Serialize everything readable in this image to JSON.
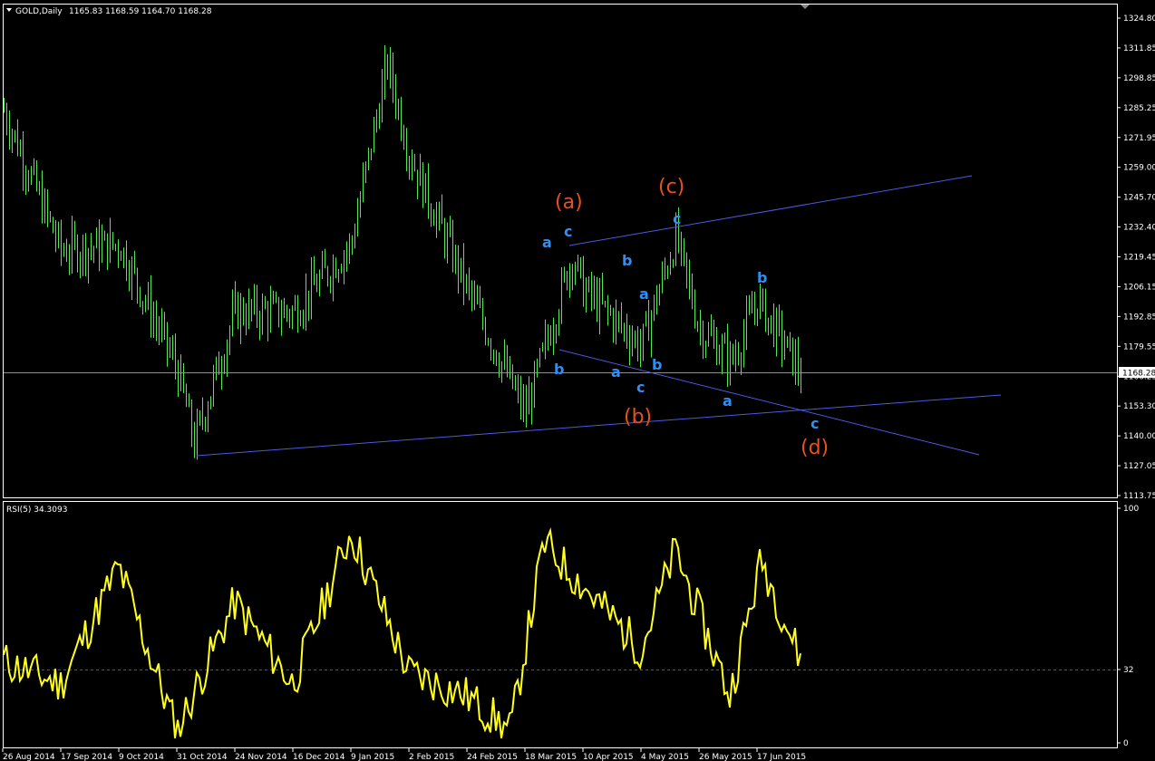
{
  "header": {
    "symbol_label": "GOLD,Daily",
    "ohlc_text": "1165.83 1168.59 1164.70 1168.28",
    "menu_icon": "triangle-down-icon",
    "scroll_marker_icon": "shift-marker-icon"
  },
  "colors": {
    "background": "#000000",
    "frame": "#ffffff",
    "candle": "#4fe84f",
    "trendline": "#4a5be0",
    "current_price_line": "#7b8ad6",
    "rsi_line": "#ffff1a",
    "rsi_level": "#3c4fc8",
    "wave_minor": "#2f8ff5",
    "wave_major": "#e8501e"
  },
  "price_panel": {
    "current_price_label": "1168.28",
    "y_ticks": [
      "1324.80",
      "1311.85",
      "1298.85",
      "1285.25",
      "1271.95",
      "1259.00",
      "1245.70",
      "1232.40",
      "1219.45",
      "1206.15",
      "1192.85",
      "1179.55",
      "1166.25",
      "1153.30",
      "1140.00",
      "1127.05",
      "1113.75"
    ]
  },
  "rsi_panel": {
    "label": "RSI(5) 34.3093",
    "y_ticks": [
      "100",
      "32",
      "0"
    ]
  },
  "x_ticks": [
    "26 Aug 2014",
    "17 Sep 2014",
    "9 Oct 2014",
    "31 Oct 2014",
    "24 Nov 2014",
    "16 Dec 2014",
    "9 Jan 2015",
    "2 Feb 2015",
    "24 Feb 2015",
    "18 Mar 2015",
    "10 Apr 2015",
    "4 May 2015",
    "26 May 2015",
    "17 Jun 2015"
  ],
  "wave_labels": {
    "minor": [
      "a",
      "c",
      "b",
      "a",
      "a",
      "b",
      "c",
      "c",
      "b",
      "a",
      "b",
      "c"
    ],
    "major": [
      "(a)",
      "(c)",
      "(b)",
      "(d)"
    ]
  },
  "chart_data": [
    {
      "type": "line",
      "name_hint": "price",
      "ylim": [
        1113.75,
        1330.0
      ],
      "last_close": 1168.28,
      "key_values": [
        {
          "x": "26 Aug 2014",
          "y": 1285
        },
        {
          "x": "17 Sep 2014",
          "y": 1222
        },
        {
          "x": "9 Oct 2014",
          "y": 1225
        },
        {
          "x": "31 Oct 2014",
          "y": 1170
        },
        {
          "x": "7 Nov 2014",
          "y": 1137
        },
        {
          "x": "24 Nov 2014",
          "y": 1195
        },
        {
          "x": "16 Dec 2014",
          "y": 1195
        },
        {
          "x": "9 Jan 2015",
          "y": 1225
        },
        {
          "x": "23 Jan 2015",
          "y": 1305
        },
        {
          "x": "2 Feb 2015",
          "y": 1265
        },
        {
          "x": "24 Feb 2015",
          "y": 1205
        },
        {
          "x": "18 Mar 2015",
          "y": 1150
        },
        {
          "x": "6 Apr 2015",
          "y": 1220
        },
        {
          "x": "10 Apr 2015",
          "y": 1205
        },
        {
          "x": "4 May 2015",
          "y": 1180
        },
        {
          "x": "15 May 2015",
          "y": 1228
        },
        {
          "x": "26 May 2015",
          "y": 1188
        },
        {
          "x": "8 Jun 2015",
          "y": 1173
        },
        {
          "x": "17 Jun 2015",
          "y": 1200
        },
        {
          "x": "30 Jun 2015",
          "y": 1168
        }
      ]
    },
    {
      "type": "line",
      "name_hint": "rsi",
      "ylim": [
        0,
        100
      ],
      "level": 32,
      "last_value": 34.3093,
      "key_values": [
        {
          "x": "26 Aug 2014",
          "y": 35
        },
        {
          "x": "17 Sep 2014",
          "y": 25
        },
        {
          "x": "9 Oct 2014",
          "y": 75
        },
        {
          "x": "31 Oct 2014",
          "y": 5
        },
        {
          "x": "24 Nov 2014",
          "y": 60
        },
        {
          "x": "16 Dec 2014",
          "y": 25
        },
        {
          "x": "9 Jan 2015",
          "y": 90
        },
        {
          "x": "2 Feb 2015",
          "y": 30
        },
        {
          "x": "24 Feb 2015",
          "y": 20
        },
        {
          "x": "18 Mar 2015",
          "y": 5
        },
        {
          "x": "6 Apr 2015",
          "y": 85
        },
        {
          "x": "4 May 2015",
          "y": 40
        },
        {
          "x": "15 May 2015",
          "y": 82
        },
        {
          "x": "26 May 2015",
          "y": 20
        },
        {
          "x": "17 Jun 2015",
          "y": 78
        },
        {
          "x": "30 Jun 2015",
          "y": 34.3
        }
      ]
    }
  ]
}
